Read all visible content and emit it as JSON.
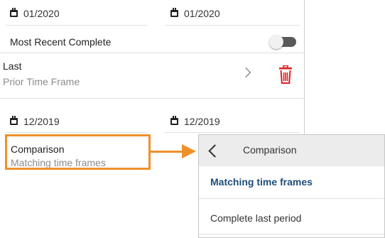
{
  "current_period": {
    "start_date": "01/2020",
    "end_date": "01/2020",
    "most_recent_complete_label": "Most Recent Complete",
    "most_recent_complete_on": false
  },
  "last_row": {
    "title": "Last",
    "subtitle": "Prior Time Frame"
  },
  "prior_period": {
    "start_date": "12/2019",
    "end_date": "12/2019"
  },
  "comparison_row": {
    "title": "Comparison",
    "subtitle": "Matching time frames"
  },
  "comparison_popup": {
    "title": "Comparison",
    "options": [
      {
        "label": "Matching time frames",
        "selected": true
      },
      {
        "label": "Complete last period",
        "selected": false
      }
    ]
  },
  "colors": {
    "highlight": "#f0902a",
    "selected_option": "#1f4e79",
    "delete_icon": "#e02020",
    "toggle_track": "#5a5a5a"
  },
  "icons": [
    "calendar-icon",
    "chevron-right-icon",
    "trash-icon",
    "chevron-left-icon",
    "arrow-right-icon"
  ]
}
